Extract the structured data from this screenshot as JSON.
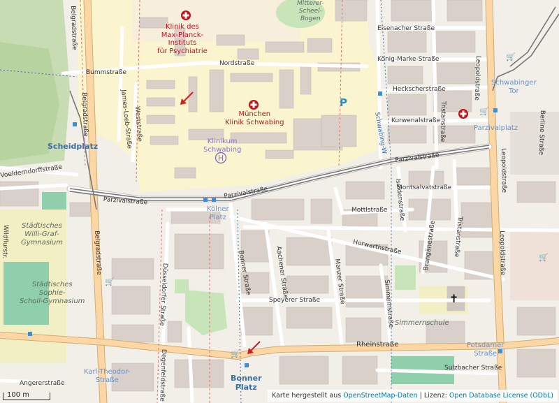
{
  "map": {
    "places": {
      "scheidplatz": "Scheidplatz",
      "karl_theodor": "Karl-Theodor-\nStraße",
      "bonner_platz": "Bonner\nPlatz",
      "koelner_platz": "Kölner\nPlatz",
      "parzivalplatz": "Parzivalplatz",
      "schwabinger_tor": "Schwabinger\nTor",
      "potsdamer": "Potsdamer\nStraße"
    },
    "pois": {
      "max_planck": "Klinik des\nMax-Planck-\nInstituts\nfür Psychiatrie",
      "klinik_schwabing": "München\nKlinik Schwabing",
      "klinikum_schwabing": "Klinikum\nSchwabing",
      "willi_graf": "Städtisches\nWilli-Graf-\nGymnasium",
      "sophie_scholl": "Städtisches\nSophie-\nScholl-Gymnasium",
      "simmernschule": "Simmernschule",
      "milbertshofen": "Mitterer-\nScheel-\nBogen"
    },
    "streets": {
      "bummstrasse": "Bummstraße",
      "nordstrasse": "Nordstraße",
      "eisenacher": "Eisenacher Straße",
      "koenig_marke": "König-Marke-Straße",
      "heckscher": "Heckscherstraße",
      "kurwenal": "Kurwenalstraße",
      "parzival_east": "Parzivalstraße",
      "parzival_mid": "Parzivalstraße",
      "parzival_west": "Parzivalstraße",
      "montsalvat": "Montsalvatstraße",
      "mottl": "Mottlstraße",
      "horwarth": "Horwarthstraße",
      "speyerer": "Speyerer Straße",
      "rhein": "Rheinstraße",
      "sulzbacher": "Sulzbacher Straße",
      "angerer": "Angererstraße",
      "voelderndorff": "Voelderndorffstraße",
      "belgrad_top": "Belgradstraße",
      "belgrad_mid": "Belgradstraße",
      "belgrad_low": "Belgradstraße",
      "james_loeb": "James-Loeb-Straße",
      "weststrasse": "Weststraße",
      "leopold_top": "Leopoldstraße",
      "leopold_mid": "Leopoldstraße",
      "leopold_low": "Leopoldstraße",
      "tristan_top": "Tristanstraße",
      "tristan_mid": "Tristanstraße",
      "isoldenstrasse": "Isoldenstraße",
      "brangaene": "Brangänestraße",
      "bonner_strasse": "Bonner Straße",
      "aachener": "Aachener Straße",
      "manzer": "Manzer Straße",
      "simmernstrasse": "Simmernstraße",
      "duesseldorfer": "Düsseldorfer Straße",
      "degenfeld": "Degenfeldstraße",
      "schwabing_west": "Schwabing-W",
      "bertine": "Berline Straße",
      "wildflurstrasse": "Wildflurstr."
    },
    "parking": "P",
    "hospital_symbol": "H",
    "church_symbol": "✝"
  },
  "scale": {
    "label": "100 m"
  },
  "attribution": {
    "prefix": "Karte hergestellt aus",
    "osm_link": "OpenStreetMap-Daten",
    "separator": " | Lizenz: ",
    "license_link": "Open Database License (ODbL)"
  },
  "colors": {
    "land": "#f2efe9",
    "hospital_area": "#fbf5cf",
    "building": "#d9d0c9",
    "park": "#c8e5b9",
    "forest": "#abd19d",
    "school_area": "#f3efc5",
    "primary_road": "#fcd6a4",
    "tram": "#6b6b6b",
    "red_poi": "#c4141a",
    "transit_blue": "#3a6ea5"
  },
  "icons": [
    "hospital-cross-icon",
    "hospital-h-icon",
    "parking-icon",
    "shop-cart-icon",
    "church-cross-icon",
    "arrow-marker-icon",
    "bus-stop-icon"
  ]
}
